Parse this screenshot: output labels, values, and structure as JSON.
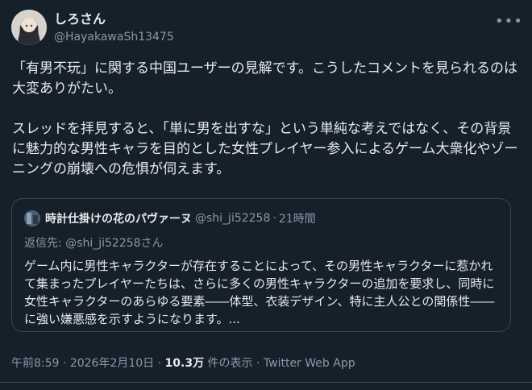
{
  "tweet": {
    "display_name": "しろさん",
    "handle": "@HayakawaSh13475",
    "more_icon": "more-horizontal-icon",
    "paragraphs": [
      "「有男不玩」に関する中国ユーザーの見解です。こうしたコメントを見られるのは大変ありがたい。",
      "スレッドを拝見すると、「単に男を出すな」という単純な考えではなく、その背景に魅力的な男性キャラを目的とした女性プレイヤー参入によるゲーム大衆化やゾーニングの崩壊への危惧が伺えます。"
    ]
  },
  "quote": {
    "display_name": "時計仕掛けの花のパヴァーヌ",
    "handle": "@shi_ji52258",
    "separator": "·",
    "time": "21時間",
    "reply_label": "返信先: ",
    "reply_handle": "@shi_ji52258さん",
    "text": "ゲーム内に男性キャラクターが存在することによって、その男性キャラクターに惹かれて集まったプレイヤーたちは、さらに多くの男性キャラクターの追加を要求し、同時に女性キャラクターのあらゆる要素――体型、衣装デザイン、特に主人公との関係性――に強い嫌悪感を示すようになります。..."
  },
  "meta": {
    "time": "午前8:59",
    "sep1": " · ",
    "date": "2026年2月10日",
    "sep2": " · ",
    "views": "10.3万",
    "views_label": " 件の表示",
    "sep3": " · ",
    "source": "Twitter Web App"
  },
  "colors": {
    "background": "#15202b",
    "text": "#e7e9ea",
    "secondary": "#8b98a5",
    "border": "#38444d"
  }
}
